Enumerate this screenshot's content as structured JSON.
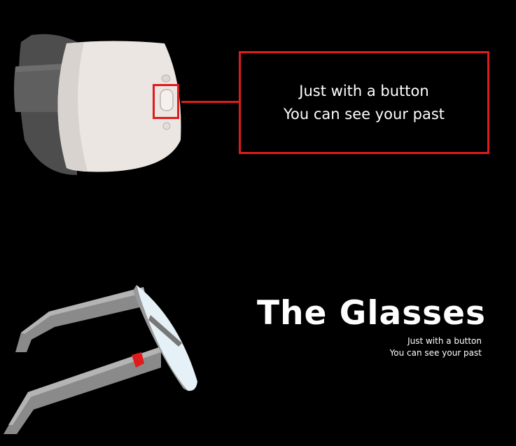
{
  "callout": {
    "line1": "Just with a button",
    "line2": "You can see your past"
  },
  "title": "The Glasses",
  "subtitle": {
    "line1": "Just with a button",
    "line2": "You can see your past"
  },
  "colors": {
    "background": "#000000",
    "accent": "#e01b1b",
    "text": "#ffffff",
    "headset_body": "#ece6e3",
    "strap": "#555555",
    "glasses_frame": "#8a8a8a",
    "glasses_button": "#e01b1b",
    "lens": "#e6f0f7"
  },
  "icons": {
    "headset": "vr-headset-icon",
    "glasses": "smart-glasses-icon"
  }
}
